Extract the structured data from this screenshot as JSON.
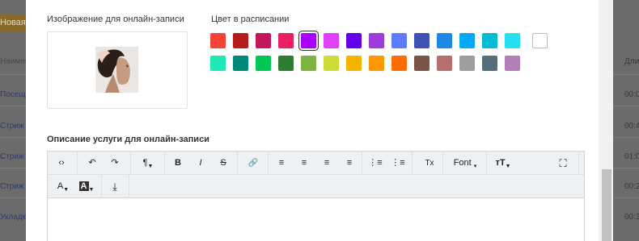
{
  "background": {
    "left": {
      "badge": "Новая",
      "column_header": "Наимен",
      "rows": [
        "Посещ",
        "Стриж",
        "Стриж",
        "Стриж",
        "Укладк"
      ]
    },
    "right": {
      "column_header": "Дли",
      "rows": [
        "00:0",
        "00:4",
        "01:0",
        "00:2",
        "00:3"
      ]
    }
  },
  "modal": {
    "image_label": "Изображение для онлайн-записи",
    "image_alt": "woman-hairstyle-photo",
    "color_label": "Цвет в расписании",
    "selected_color": "#aa00ff",
    "colors_row1": [
      "#f44336",
      "#b71c1c",
      "#c2185b",
      "#e91e63",
      "#aa00ff",
      "#e040fb",
      "#6200ea",
      "#9c3cd9",
      "#5f7cff",
      "#3f51b5",
      "#1e88e5",
      "#03a9f4",
      "#00bcd4",
      "#26e0f0"
    ],
    "colors_row2": [
      "#1de9b6",
      "#00897b",
      "#00c853",
      "#2e7d32",
      "#7cb342",
      "#cddc39",
      "#f4b400",
      "#ff9800",
      "#ff6d00",
      "#795548",
      "#b76e6e",
      "#9e9e9e",
      "#546e7a",
      "#b47fb8"
    ],
    "extra_color": "#ffffff",
    "description_label": "Описание услуги для онлайн-записи",
    "editor": {
      "row1": [
        {
          "name": "code-view-button",
          "icon": "code-icon",
          "glyph": "‹›"
        },
        {
          "name": "undo-button",
          "icon": "undo-icon",
          "glyph": "↶"
        },
        {
          "name": "redo-button",
          "icon": "redo-icon",
          "glyph": "↷"
        },
        {
          "name": "paragraph-format-button",
          "icon": "paragraph-icon",
          "glyph": "¶"
        },
        {
          "name": "bold-button",
          "icon": "bold-icon",
          "glyph": "B"
        },
        {
          "name": "italic-button",
          "icon": "italic-icon",
          "glyph": "I"
        },
        {
          "name": "strikethrough-button",
          "icon": "strikethrough-icon",
          "glyph": "S"
        },
        {
          "name": "link-button",
          "icon": "link-icon",
          "glyph": "🔗"
        },
        {
          "name": "align-left-button",
          "icon": "align-left-icon",
          "glyph": "≡"
        },
        {
          "name": "align-center-button",
          "icon": "align-center-icon",
          "glyph": "≡"
        },
        {
          "name": "align-right-button",
          "icon": "align-right-icon",
          "glyph": "≡"
        },
        {
          "name": "align-justify-button",
          "icon": "align-justify-icon",
          "glyph": "≡"
        },
        {
          "name": "bulleted-list-button",
          "icon": "bulleted-list-icon",
          "glyph": "⋮≡"
        },
        {
          "name": "numbered-list-button",
          "icon": "numbered-list-icon",
          "glyph": "⋮≡"
        },
        {
          "name": "clear-format-button",
          "icon": "clear-format-icon",
          "glyph": "Tx"
        }
      ],
      "font_label": "Font",
      "font_size_glyph": "тT",
      "fullscreen_icon": "fullscreen-icon",
      "row2": [
        {
          "name": "text-color-button",
          "icon": "text-color-icon",
          "glyph": "A"
        },
        {
          "name": "background-color-button",
          "icon": "background-color-icon",
          "glyph": "A"
        },
        {
          "name": "insert-file-button",
          "icon": "download-icon",
          "glyph": "⤓"
        }
      ]
    }
  }
}
